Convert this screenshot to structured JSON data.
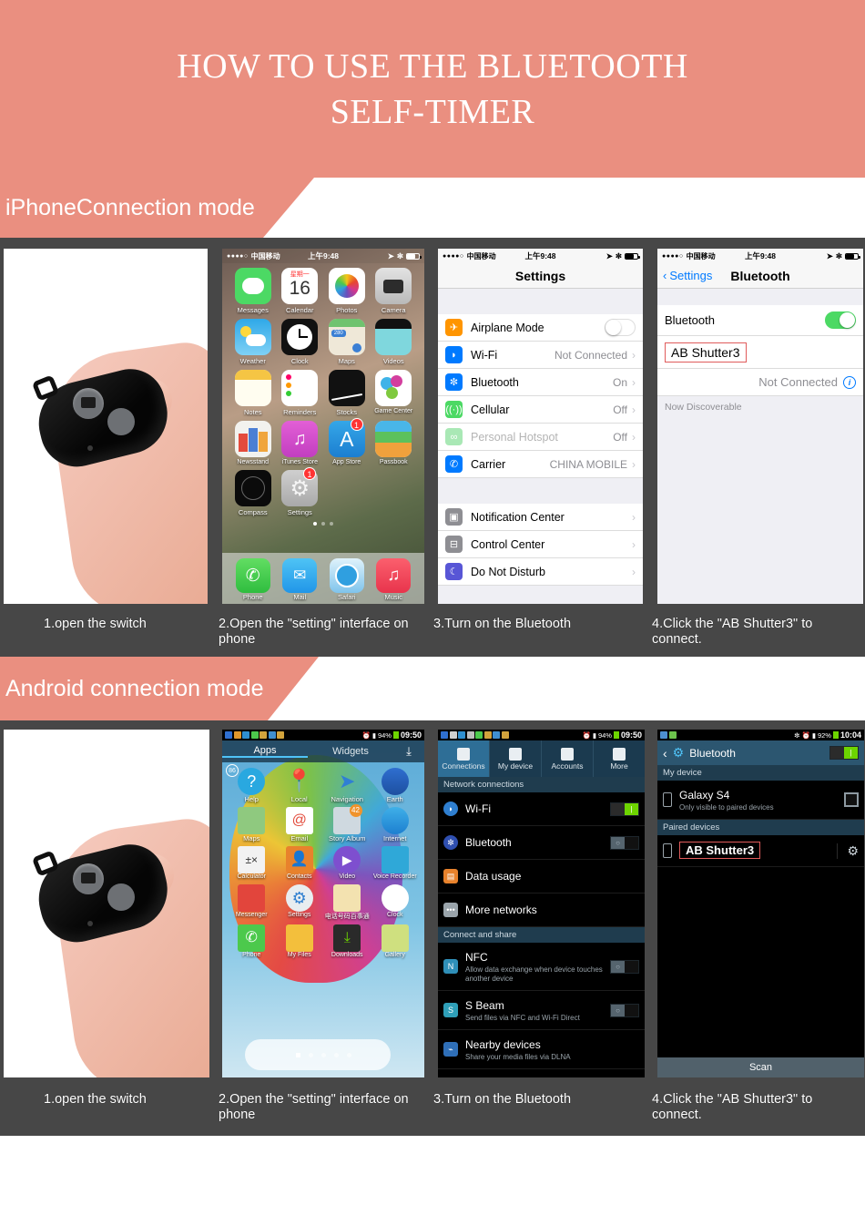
{
  "hero": {
    "title_line1": "HOW TO USE THE BLUETOOTH",
    "title_line2": "SELF-TIMER"
  },
  "colors": {
    "accent": "#ea8f80",
    "strip": "#474747",
    "ios_green": "#4cd964",
    "ios_blue": "#007aff",
    "android_green": "#6dd400",
    "highlight_red": "#e05b5b"
  },
  "sections": [
    {
      "banner": "iPhoneConnection mode"
    },
    {
      "banner": "Android connection mode"
    }
  ],
  "captions": {
    "step1": "1.open the switch",
    "step2": "2.Open the \"setting\" interface on phone",
    "step3": "3.Turn on the Bluetooth",
    "step4": "4.Click the \"AB Shutter3\" to connect."
  },
  "ios": {
    "status": {
      "carrier": "中国移动",
      "time": "上午9:48",
      "dots": "●●●●○"
    },
    "home": {
      "apps": [
        [
          "Messages",
          "Calendar",
          "Photos",
          "Camera"
        ],
        [
          "Weather",
          "Clock",
          "Maps",
          "Videos"
        ],
        [
          "Notes",
          "Reminders",
          "Stocks",
          "Game Center"
        ],
        [
          "Newsstand",
          "iTunes Store",
          "App Store",
          "Passbook"
        ],
        [
          "Compass",
          "Settings",
          "",
          ""
        ]
      ],
      "dock": [
        "Phone",
        "Mail",
        "Safari",
        "Music"
      ],
      "calendar_weekday": "星期一",
      "calendar_day": "16",
      "badges": {
        "app_store": "1",
        "settings": "1"
      }
    },
    "settings": {
      "title": "Settings",
      "group1": [
        {
          "label": "Airplane Mode",
          "value": "",
          "control": "toggle-off",
          "icon": "airplane-icon"
        },
        {
          "label": "Wi-Fi",
          "value": "Not Connected",
          "control": "chevron",
          "icon": "wifi-icon"
        },
        {
          "label": "Bluetooth",
          "value": "On",
          "control": "chevron",
          "icon": "bluetooth-icon"
        },
        {
          "label": "Cellular",
          "value": "Off",
          "control": "chevron",
          "icon": "cellular-icon"
        },
        {
          "label": "Personal Hotspot",
          "value": "Off",
          "control": "chevron",
          "icon": "hotspot-icon",
          "dim": true
        },
        {
          "label": "Carrier",
          "value": "CHINA MOBILE",
          "control": "chevron",
          "icon": "phone-icon"
        }
      ],
      "group2": [
        {
          "label": "Notification Center",
          "value": "",
          "control": "chevron",
          "icon": "notification-icon"
        },
        {
          "label": "Control Center",
          "value": "",
          "control": "chevron",
          "icon": "control-center-icon"
        },
        {
          "label": "Do Not Disturb",
          "value": "",
          "control": "chevron",
          "icon": "moon-icon"
        }
      ]
    },
    "bluetooth": {
      "back_label": "Settings",
      "title": "Bluetooth",
      "toggle_label": "Bluetooth",
      "toggle_state": "on",
      "device_name": "AB Shutter3",
      "device_status": "Not Connected",
      "discoverable": "Now Discoverable"
    }
  },
  "android": {
    "status": {
      "battery": "94%",
      "time": "09:50"
    },
    "status_bt": {
      "battery": "92%",
      "time": "10:04"
    },
    "apps_screen": {
      "tab_apps": "Apps",
      "tab_widgets": "Widgets",
      "badge": "86",
      "rows": [
        [
          "Help",
          "Local",
          "Navigation",
          "Earth"
        ],
        [
          "Maps",
          "Email",
          "Story Album",
          "Internet"
        ],
        [
          "Calculator",
          "Contacts",
          "Video",
          "Voice Recorder"
        ],
        [
          "Messenger",
          "Settings",
          "电话号码百事通",
          "Clock"
        ],
        [
          "Phone",
          "My Files",
          "Downloads",
          "Gallery"
        ]
      ],
      "story_album_badge": "42"
    },
    "settings": {
      "tabs": [
        "Connections",
        "My device",
        "Accounts",
        "More"
      ],
      "active_tab": "Connections",
      "section1": "Network connections",
      "rows1": [
        {
          "label": "Wi-Fi",
          "sub": "",
          "control": "toggle-on",
          "icon": "wifi-icon"
        },
        {
          "label": "Bluetooth",
          "sub": "",
          "control": "toggle-off",
          "icon": "bluetooth-icon"
        },
        {
          "label": "Data usage",
          "sub": "",
          "control": "none",
          "icon": "chart-icon"
        },
        {
          "label": "More networks",
          "sub": "",
          "control": "none",
          "icon": "more-icon"
        }
      ],
      "section2": "Connect and share",
      "rows2": [
        {
          "label": "NFC",
          "sub": "Allow data exchange when device touches another device",
          "control": "toggle-off",
          "icon": "nfc-icon"
        },
        {
          "label": "S Beam",
          "sub": "Send files via NFC and Wi-Fi Direct",
          "control": "toggle-off",
          "icon": "sbeam-icon"
        },
        {
          "label": "Nearby devices",
          "sub": "Share your media files via DLNA",
          "control": "none",
          "icon": "nearby-icon"
        }
      ]
    },
    "bluetooth": {
      "title": "Bluetooth",
      "toggle_state": "on",
      "section_my_device": "My device",
      "my_device_name": "Galaxy S4",
      "my_device_sub": "Only visible to paired devices",
      "section_paired": "Paired devices",
      "paired_device": "AB Shutter3",
      "scan_label": "Scan"
    }
  }
}
